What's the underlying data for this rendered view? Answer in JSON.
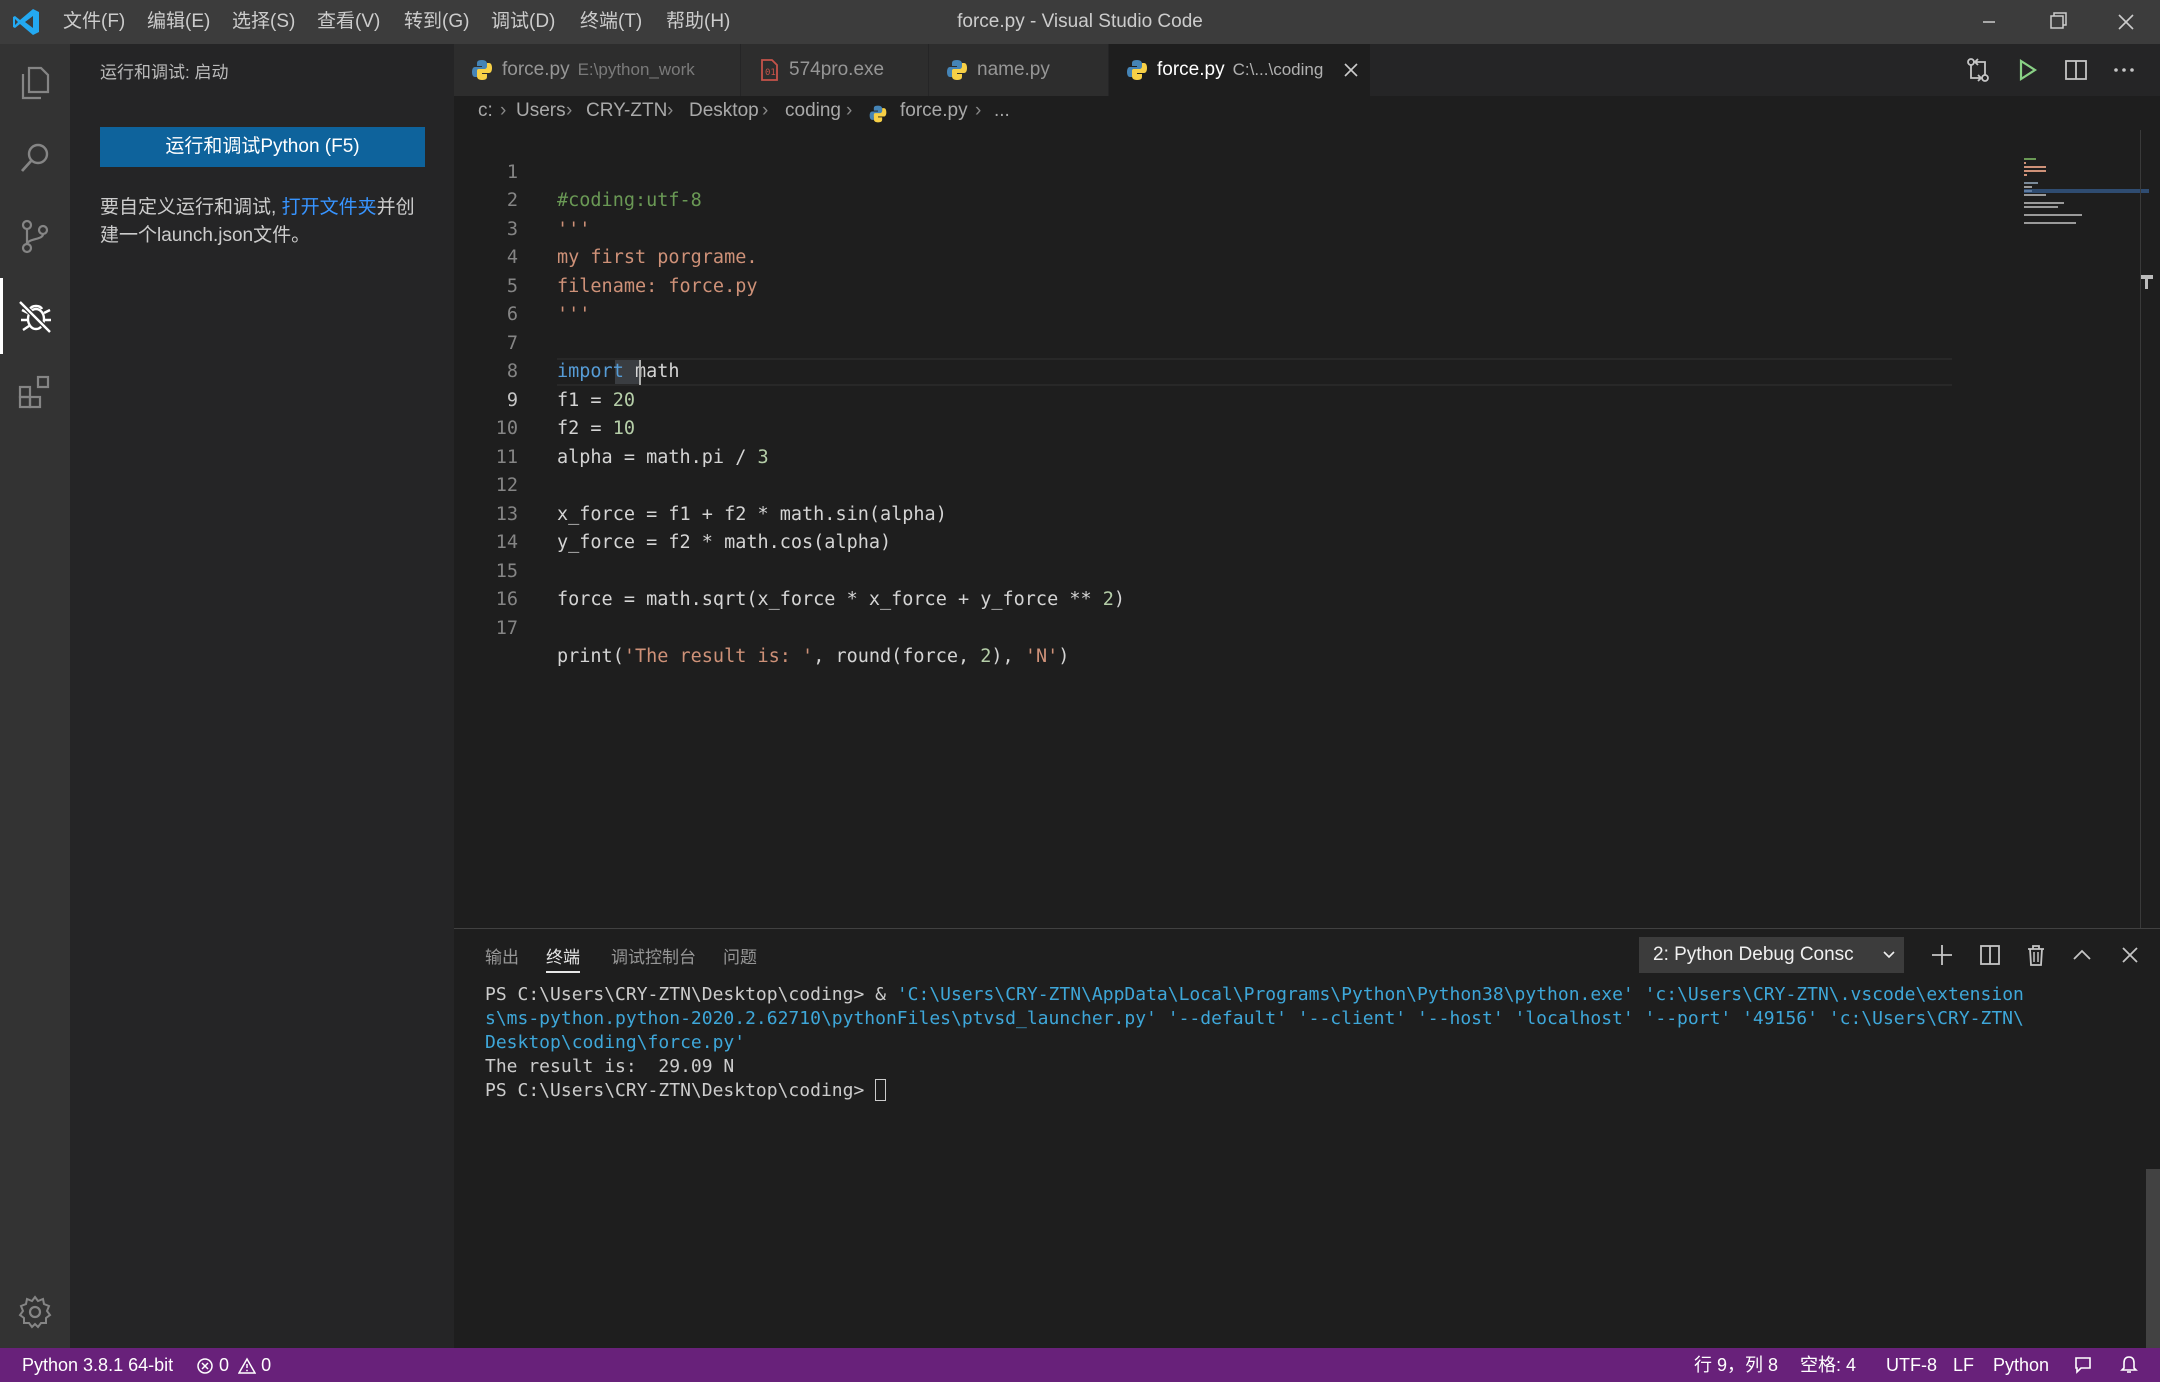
{
  "titlebar": {
    "menu": [
      "文件(F)",
      "编辑(E)",
      "选择(S)",
      "查看(V)",
      "转到(G)",
      "调试(D)",
      "终端(T)",
      "帮助(H)"
    ],
    "title": "force.py - Visual Studio Code"
  },
  "activity_bar": {
    "items": [
      "explorer-icon",
      "search-icon",
      "source-control-icon",
      "debug-icon",
      "extensions-icon"
    ],
    "active": "debug-icon",
    "bottom": "gear-icon"
  },
  "sidebar": {
    "title": "运行和调试: 启动",
    "run_button": "运行和调试Python (F5)",
    "desc_before": "要自定义运行和调试, ",
    "desc_link": "打开文件夹",
    "desc_after": "并创建一个launch.json文件。"
  },
  "tabs": [
    {
      "label": "force.py",
      "desc": "E:\\python_work",
      "icon": "python-icon",
      "active": false
    },
    {
      "label": "574pro.exe",
      "desc": "",
      "icon": "binary-file-icon",
      "active": false
    },
    {
      "label": "name.py",
      "desc": "",
      "icon": "python-icon",
      "active": false
    },
    {
      "label": "force.py",
      "desc": "C:\\...\\coding",
      "icon": "python-icon",
      "active": true
    }
  ],
  "breadcrumb": [
    "c:",
    "Users",
    "CRY-ZTN",
    "Desktop",
    "coding",
    "force.py",
    "..."
  ],
  "editor": {
    "line_numbers": [
      "1",
      "2",
      "3",
      "4",
      "5",
      "6",
      "7",
      "8",
      "9",
      "10",
      "11",
      "12",
      "13",
      "14",
      "15",
      "16",
      "17"
    ],
    "lines": [
      "#coding:utf-8",
      "'''",
      "my first porgrame.",
      "filename: force.py",
      "'''",
      "",
      "import math",
      "f1 = 20",
      "f2 = 10",
      "alpha = math.pi / 3",
      "",
      "x_force = f1 + f2 * math.sin(alpha)",
      "y_force = f2 * math.cos(alpha)",
      "",
      "force = math.sqrt(x_force * x_force + y_force ** 2)",
      "",
      "print('The result is: ', round(force, 2), 'N')"
    ],
    "current_line": 9
  },
  "panel": {
    "tabs": [
      "输出",
      "终端",
      "调试控制台",
      "问题"
    ],
    "active_tab": "终端",
    "terminal_select": "2: Python Debug Consc",
    "prompt": "PS C:\\Users\\CRY-ZTN\\Desktop\\coding> ",
    "cmd_amp": "& ",
    "cmd_line1": "'C:\\Users\\CRY-ZTN\\AppData\\Local\\Programs\\Python\\Python38\\python.exe' 'c:\\Users\\CRY-ZTN\\.vscode\\extension",
    "cmd_line2": "s\\ms-python.python-2020.2.62710\\pythonFiles\\ptvsd_launcher.py' '--default' '--client' '--host' 'localhost' '--port' '49156' 'c:\\Users\\CRY-ZTN\\",
    "cmd_line3": "Desktop\\coding\\force.py'",
    "result": "The result is:  29.09 N",
    "prompt2": "PS C:\\Users\\CRY-ZTN\\Desktop\\coding> "
  },
  "statusbar": {
    "interpreter": "Python 3.8.1 64-bit",
    "errors": "0",
    "warnings": "0",
    "position": "行 9，列 8",
    "spaces": "空格: 4",
    "encoding": "UTF-8",
    "eol": "LF",
    "language": "Python"
  },
  "colors": {
    "statusbar": "#68217a",
    "button": "#0e639c",
    "accent_link": "#3794ff"
  }
}
